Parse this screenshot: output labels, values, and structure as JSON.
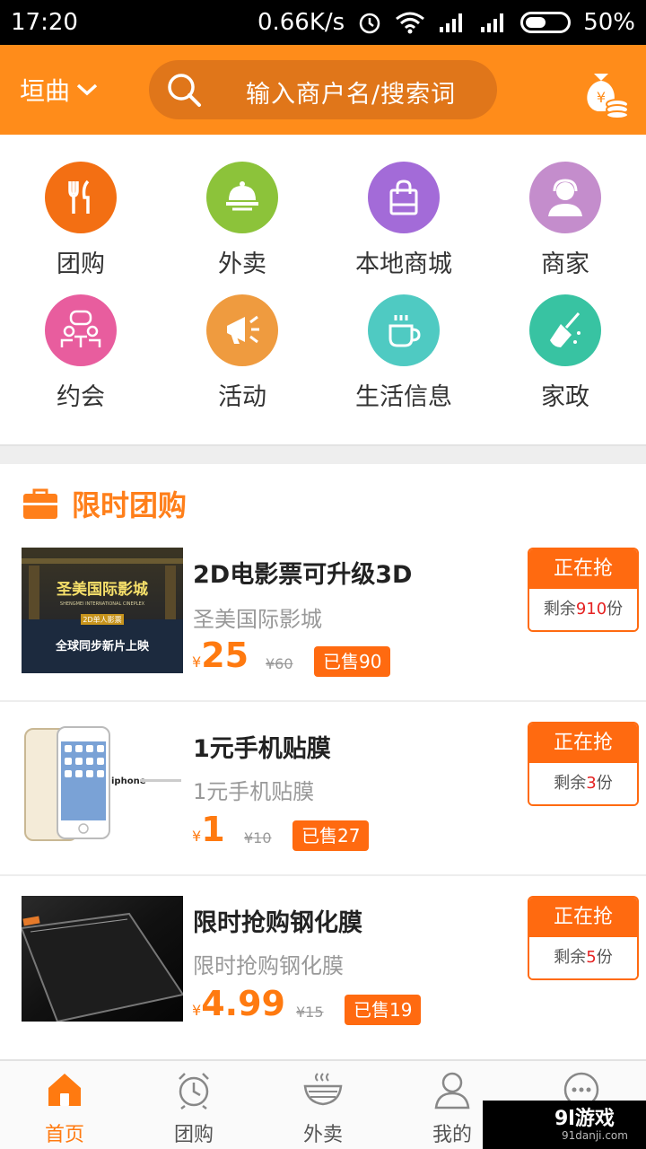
{
  "statusbar": {
    "time": "17:20",
    "net_speed": "0.66K/s",
    "battery": "50%"
  },
  "header": {
    "city": "垣曲",
    "search_placeholder": "输入商户名/搜索词"
  },
  "categories": [
    {
      "label": "团购",
      "icon": "fork-knife-icon",
      "color": "#f36f13"
    },
    {
      "label": "外卖",
      "icon": "food-dome-icon",
      "color": "#8cc33a"
    },
    {
      "label": "本地商城",
      "icon": "shopping-bag-icon",
      "color": "#a36bd8"
    },
    {
      "label": "商家",
      "icon": "merchant-icon",
      "color": "#c48dcc"
    },
    {
      "label": "约会",
      "icon": "date-icon",
      "color": "#e85d9e"
    },
    {
      "label": "活动",
      "icon": "megaphone-icon",
      "color": "#ef9b3f"
    },
    {
      "label": "生活信息",
      "icon": "coffee-cup-icon",
      "color": "#4fcac2"
    },
    {
      "label": "家政",
      "icon": "broom-icon",
      "color": "#38c3a2"
    }
  ],
  "section": {
    "title": "限时团购"
  },
  "deals": [
    {
      "title": "2D电影票可升级3D",
      "subtitle": "圣美国际影城",
      "yen": "¥",
      "price": "25",
      "orig": "¥60",
      "sold": "已售90",
      "grab": "正在抢",
      "remain_prefix": "剩余",
      "remain": "910",
      "remain_suffix": "份",
      "thumb": {
        "name": "圣美国际影城",
        "en": "SHENGMEI INTERNATIONAL CINEPLEX",
        "badge": "2D单人影票",
        "slogan": "全球同步新片上映"
      }
    },
    {
      "title": "1元手机贴膜",
      "subtitle": "1元手机贴膜",
      "yen": "¥",
      "price": "1",
      "orig": "¥10",
      "sold": "已售27",
      "grab": "正在抢",
      "remain_prefix": "剩余",
      "remain": "3",
      "remain_suffix": "份",
      "thumb": {
        "brand": "iphone"
      }
    },
    {
      "title": "限时抢购钢化膜",
      "subtitle": "限时抢购钢化膜",
      "yen": "¥",
      "price": "4.99",
      "orig": "¥15",
      "sold": "已售19",
      "grab": "正在抢",
      "remain_prefix": "剩余",
      "remain": "5",
      "remain_suffix": "份",
      "thumb": {}
    }
  ],
  "bottomnav": [
    {
      "label": "首页",
      "icon": "home-icon",
      "active": true
    },
    {
      "label": "团购",
      "icon": "alarm-clock-icon"
    },
    {
      "label": "外卖",
      "icon": "bowl-icon"
    },
    {
      "label": "我的",
      "icon": "user-icon"
    },
    {
      "label": "",
      "icon": "more-icon"
    }
  ],
  "watermark": {
    "brand": "9l游戏",
    "site": "91danji.com"
  }
}
